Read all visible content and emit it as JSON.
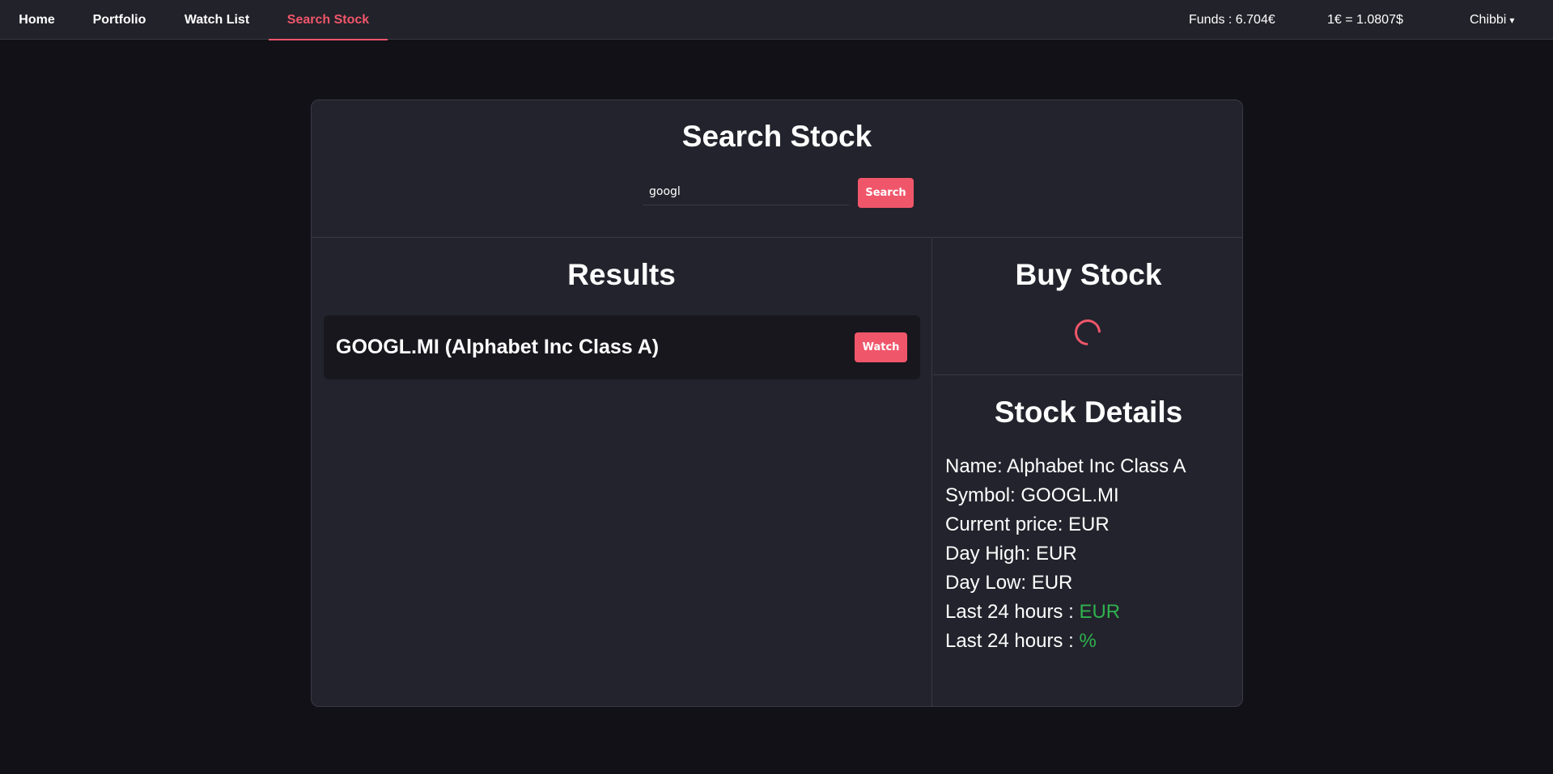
{
  "nav": {
    "items": [
      {
        "label": "Home"
      },
      {
        "label": "Portfolio"
      },
      {
        "label": "Watch List"
      },
      {
        "label": "Search Stock"
      }
    ],
    "funds": "Funds : 6.704€",
    "exchange_rate": "1€ = 1.0807$",
    "user": "Chibbi",
    "user_caret": "▾"
  },
  "search": {
    "title": "Search Stock",
    "query": "googl",
    "button_label": "Search"
  },
  "results": {
    "title": "Results",
    "items": [
      {
        "label": "GOOGL.MI (Alphabet Inc Class A)",
        "button_label": "Watch"
      }
    ]
  },
  "buy": {
    "title": "Buy Stock"
  },
  "details": {
    "title": "Stock Details",
    "name": "Name: Alphabet Inc Class A",
    "symbol": "Symbol: GOOGL.MI",
    "current_price": "Current price: EUR",
    "day_high": "Day High: EUR",
    "day_low": "Day Low: EUR",
    "change_abs_label": "Last 24 hours : ",
    "change_abs_value": "EUR",
    "change_pct_label": "Last 24 hours : ",
    "change_pct_value": "%"
  },
  "colors": {
    "accent": "#f0566a",
    "positive": "#2fb24e",
    "background": "#121117",
    "panel": "#23232d"
  }
}
